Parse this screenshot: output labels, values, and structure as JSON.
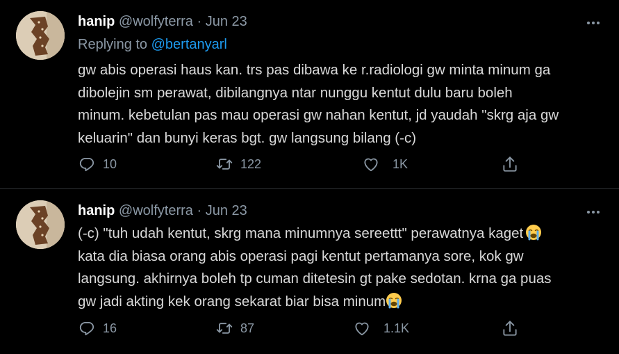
{
  "tweets": [
    {
      "author_name": "hanip",
      "author_handle": "@wolfyterra",
      "separator": "·",
      "date": "Jun 23",
      "replying_prefix": "Replying to",
      "replying_to": "@bertanyarl",
      "lines": [
        "gw abis operasi haus kan. trs pas dibawa ke r.radiologi gw minta minum ga",
        "dibolejin sm perawat, dibilangnya ntar nunggu kentut dulu baru boleh",
        "minum. kebetulan pas mau operasi gw nahan kentut, jd yaudah \"skrg aja gw",
        "keluarin\" dan bunyi keras bgt. gw langsung bilang (-c)"
      ],
      "replies": "10",
      "retweets": "122",
      "likes": "1K"
    },
    {
      "author_name": "hanip",
      "author_handle": "@wolfyterra",
      "separator": "·",
      "date": "Jun 23",
      "lines": [
        "(-c) \"tuh udah kentut, skrg mana minumnya sereettt\" perawatnya kaget",
        "kata dia biasa orang abis operasi pagi kentut pertamanya sore, kok gw",
        "langsung. akhirnya boleh tp cuman ditetesin gt pake sedotan. krna ga puas",
        "gw jadi akting kek orang sekarat biar bisa minum"
      ],
      "replies": "16",
      "retweets": "87",
      "likes": "1.1K"
    }
  ],
  "icons": {
    "reply": "comment-icon",
    "retweet": "retweet-icon",
    "like": "heart-icon",
    "share": "share-icon",
    "more": "more-dots-icon",
    "emoji": "loudly-crying-face-emoji"
  },
  "colors": {
    "background": "#000000",
    "text": "#d9d9d9",
    "muted": "#8b98a5",
    "link": "#1d9bf0",
    "divider": "#2f3336"
  }
}
